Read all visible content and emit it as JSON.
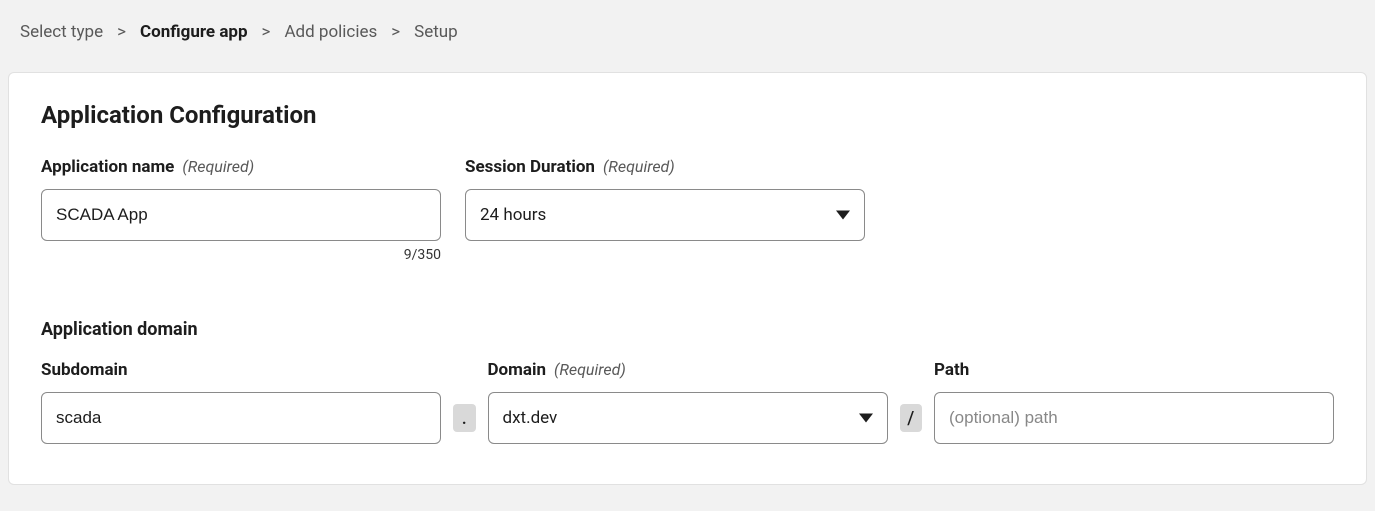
{
  "breadcrumb": {
    "items": [
      {
        "label": "Select type"
      },
      {
        "label": "Configure app"
      },
      {
        "label": "Add policies"
      },
      {
        "label": "Setup"
      }
    ],
    "separator": ">",
    "active_index": 1
  },
  "card": {
    "title": "Application Configuration",
    "appName": {
      "label": "Application name",
      "required_text": "(Required)",
      "value": "SCADA App",
      "char_count": "9/350"
    },
    "sessionDuration": {
      "label": "Session Duration",
      "required_text": "(Required)",
      "value": "24 hours"
    },
    "appDomainSection": {
      "label": "Application domain"
    },
    "subdomain": {
      "label": "Subdomain",
      "value": "scada"
    },
    "domain": {
      "label": "Domain",
      "required_text": "(Required)",
      "value": "dxt.dev"
    },
    "path": {
      "label": "Path",
      "placeholder": "(optional) path",
      "value": ""
    },
    "joiners": {
      "dot": ".",
      "slash": "/"
    }
  }
}
